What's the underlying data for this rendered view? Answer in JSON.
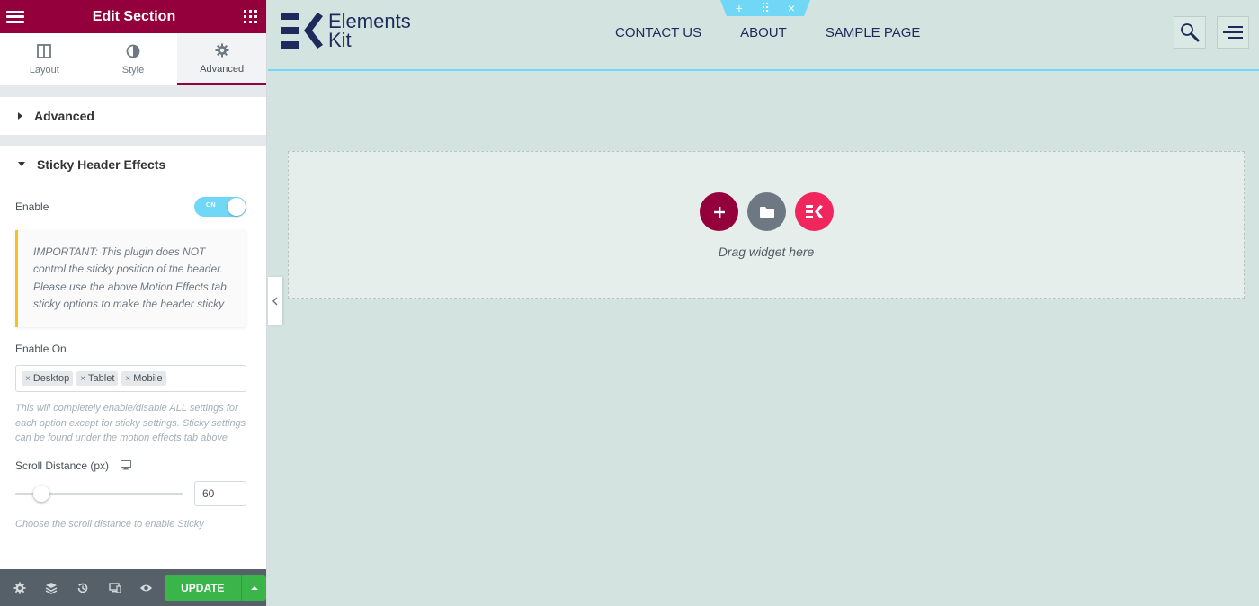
{
  "panel": {
    "title": "Edit Section",
    "tabs": [
      {
        "label": "Layout",
        "icon": "layout-columns-icon"
      },
      {
        "label": "Style",
        "icon": "half-circle-style-icon"
      },
      {
        "label": "Advanced",
        "icon": "gear-icon",
        "active": true
      }
    ],
    "sections": {
      "advanced": "Advanced",
      "sticky": "Sticky Header Effects"
    },
    "enable": {
      "label": "Enable",
      "switch_text": "ON",
      "on": true
    },
    "notice": "IMPORTANT: This plugin does NOT control the sticky position of the header. Please use the above Motion Effects tab sticky options to make the header sticky",
    "enable_on": {
      "label": "Enable On",
      "options": [
        "Desktop",
        "Tablet",
        "Mobile"
      ],
      "remove_glyph": "×",
      "description": "This will completely enable/disable ALL settings for each option except for sticky settings. Sticky settings can be found under the motion effects tab above"
    },
    "scroll_distance": {
      "label": "Scroll Distance (px)",
      "value": "60",
      "slider_fraction": 0.12,
      "description": "Choose the scroll distance to enable Sticky"
    },
    "footer": {
      "icons": [
        "settings-icon",
        "navigator-layers-icon",
        "history-icon",
        "responsive-icon",
        "preview-eye-icon"
      ],
      "update_label": "UPDATE"
    }
  },
  "site": {
    "logo_line1": "Elements",
    "logo_line2": "Kit",
    "nav": [
      "CONTACT US",
      "ABOUT",
      "SAMPLE PAGE"
    ],
    "section_handle": {
      "add": "+",
      "drag": "⠿",
      "close": "×"
    }
  },
  "drop_zone": {
    "text": "Drag widget here"
  },
  "colors": {
    "accent": "#93003c",
    "canvas_bg": "#d3e3df",
    "update": "#39b54a",
    "handle": "#71d7f7",
    "ek_pink": "#f0265c"
  }
}
